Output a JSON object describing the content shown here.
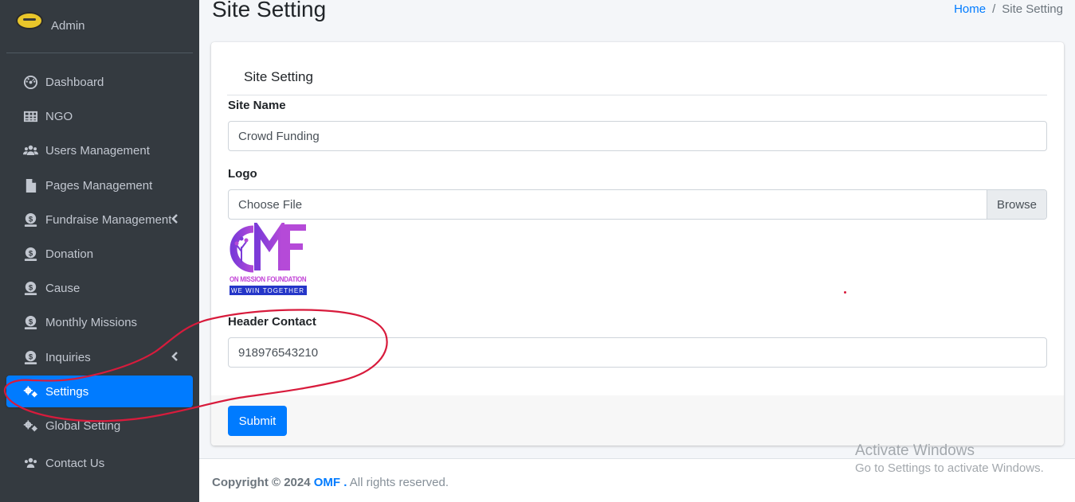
{
  "user": {
    "name": "Admin"
  },
  "sidebar": {
    "items": [
      {
        "label": "Dashboard",
        "icon": "dashboard-icon"
      },
      {
        "label": "NGO",
        "icon": "table-icon"
      },
      {
        "label": "Users Management",
        "icon": "users-icon"
      },
      {
        "label": "Pages Management",
        "icon": "file-icon"
      },
      {
        "label": "Fundraise Management",
        "icon": "dollar-icon",
        "expandable": true
      },
      {
        "label": "Donation",
        "icon": "dollar-icon"
      },
      {
        "label": "Cause",
        "icon": "dollar-icon"
      },
      {
        "label": "Monthly Missions",
        "icon": "dollar-icon"
      },
      {
        "label": "Inquiries",
        "icon": "dollar-icon",
        "expandable": true
      },
      {
        "label": "Settings",
        "icon": "cogs-icon",
        "active": true
      },
      {
        "label": "Global Setting",
        "icon": "cogs-icon"
      },
      {
        "label": "Contact Us",
        "icon": "users-icon"
      }
    ]
  },
  "header": {
    "title": "Site Setting",
    "breadcrumb": {
      "home": "Home",
      "separator": "/",
      "current": "Site Setting"
    }
  },
  "form": {
    "card_title": "Site Setting",
    "site_name": {
      "label": "Site Name",
      "value": "Crowd Funding"
    },
    "logo": {
      "label": "Logo",
      "file_placeholder": "Choose File",
      "browse_label": "Browse",
      "image_text": {
        "initials": "OMF",
        "line1": "ON MISSION FOUNDATION",
        "line2": "WE WIN TOGETHER"
      }
    },
    "header_contact": {
      "label": "Header Contact",
      "value": "918976543210"
    },
    "submit_label": "Submit"
  },
  "footer": {
    "copyright_prefix": "Copyright © 2024",
    "brand": "OMF .",
    "suffix": "All rights reserved."
  },
  "watermark": {
    "line1": "Activate Windows",
    "line2": "Go to Settings to activate Windows."
  },
  "colors": {
    "sidebar_bg": "#343a40",
    "accent": "#007bff",
    "annotation": "#d81b3c"
  }
}
